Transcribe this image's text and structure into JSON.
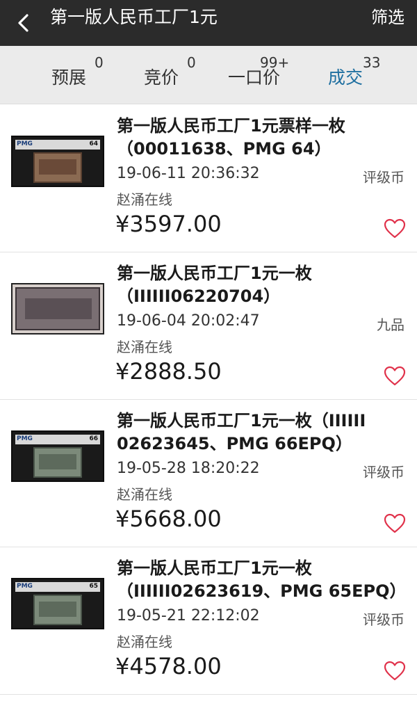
{
  "header": {
    "title": "第一版人民币工厂1元",
    "filter_label": "筛选"
  },
  "tabs": [
    {
      "label": "预展",
      "count": "0",
      "active": false
    },
    {
      "label": "竞价",
      "count": "0",
      "active": false
    },
    {
      "label": "一口价",
      "count": "99+",
      "active": false
    },
    {
      "label": "成交",
      "count": "33",
      "active": true
    }
  ],
  "colors": {
    "header_bg": "#2b2b2b",
    "tab_bar_bg": "#ebebeb",
    "active_tab": "#1f6fa0",
    "heart": "#e0314a"
  },
  "items": [
    {
      "title_line1": "第一版人民币工厂1元票样一枚",
      "title_line2": "（00011638、PMG 64）",
      "time": "19-06-11 20:36:32",
      "tag": "评级币",
      "seller": "赵涌在线",
      "price": "¥3597.00",
      "thumb_brand": "PMG",
      "thumb_grade": "64",
      "icon": "heart-icon"
    },
    {
      "title_line1": "第一版人民币工厂1元一枚",
      "title_line2": "（IIIIII06220704）",
      "time": "19-06-04 20:02:47",
      "tag": "九品",
      "seller": "赵涌在线",
      "price": "¥2888.50",
      "icon": "heart-icon"
    },
    {
      "title_line1": "第一版人民币工厂1元一枚（IIIIII",
      "title_line2": "02623645、PMG 66EPQ）",
      "time": "19-05-28 18:20:22",
      "tag": "评级币",
      "seller": "赵涌在线",
      "price": "¥5668.00",
      "thumb_brand": "PMG",
      "thumb_grade": "66",
      "icon": "heart-icon"
    },
    {
      "title_line1": "第一版人民币工厂1元一枚",
      "title_line2": "（IIIIII02623619、PMG 65EPQ）",
      "time": "19-05-21 22:12:02",
      "tag": "评级币",
      "seller": "赵涌在线",
      "price": "¥4578.00",
      "thumb_brand": "PMG",
      "thumb_grade": "65",
      "icon": "heart-icon"
    }
  ]
}
